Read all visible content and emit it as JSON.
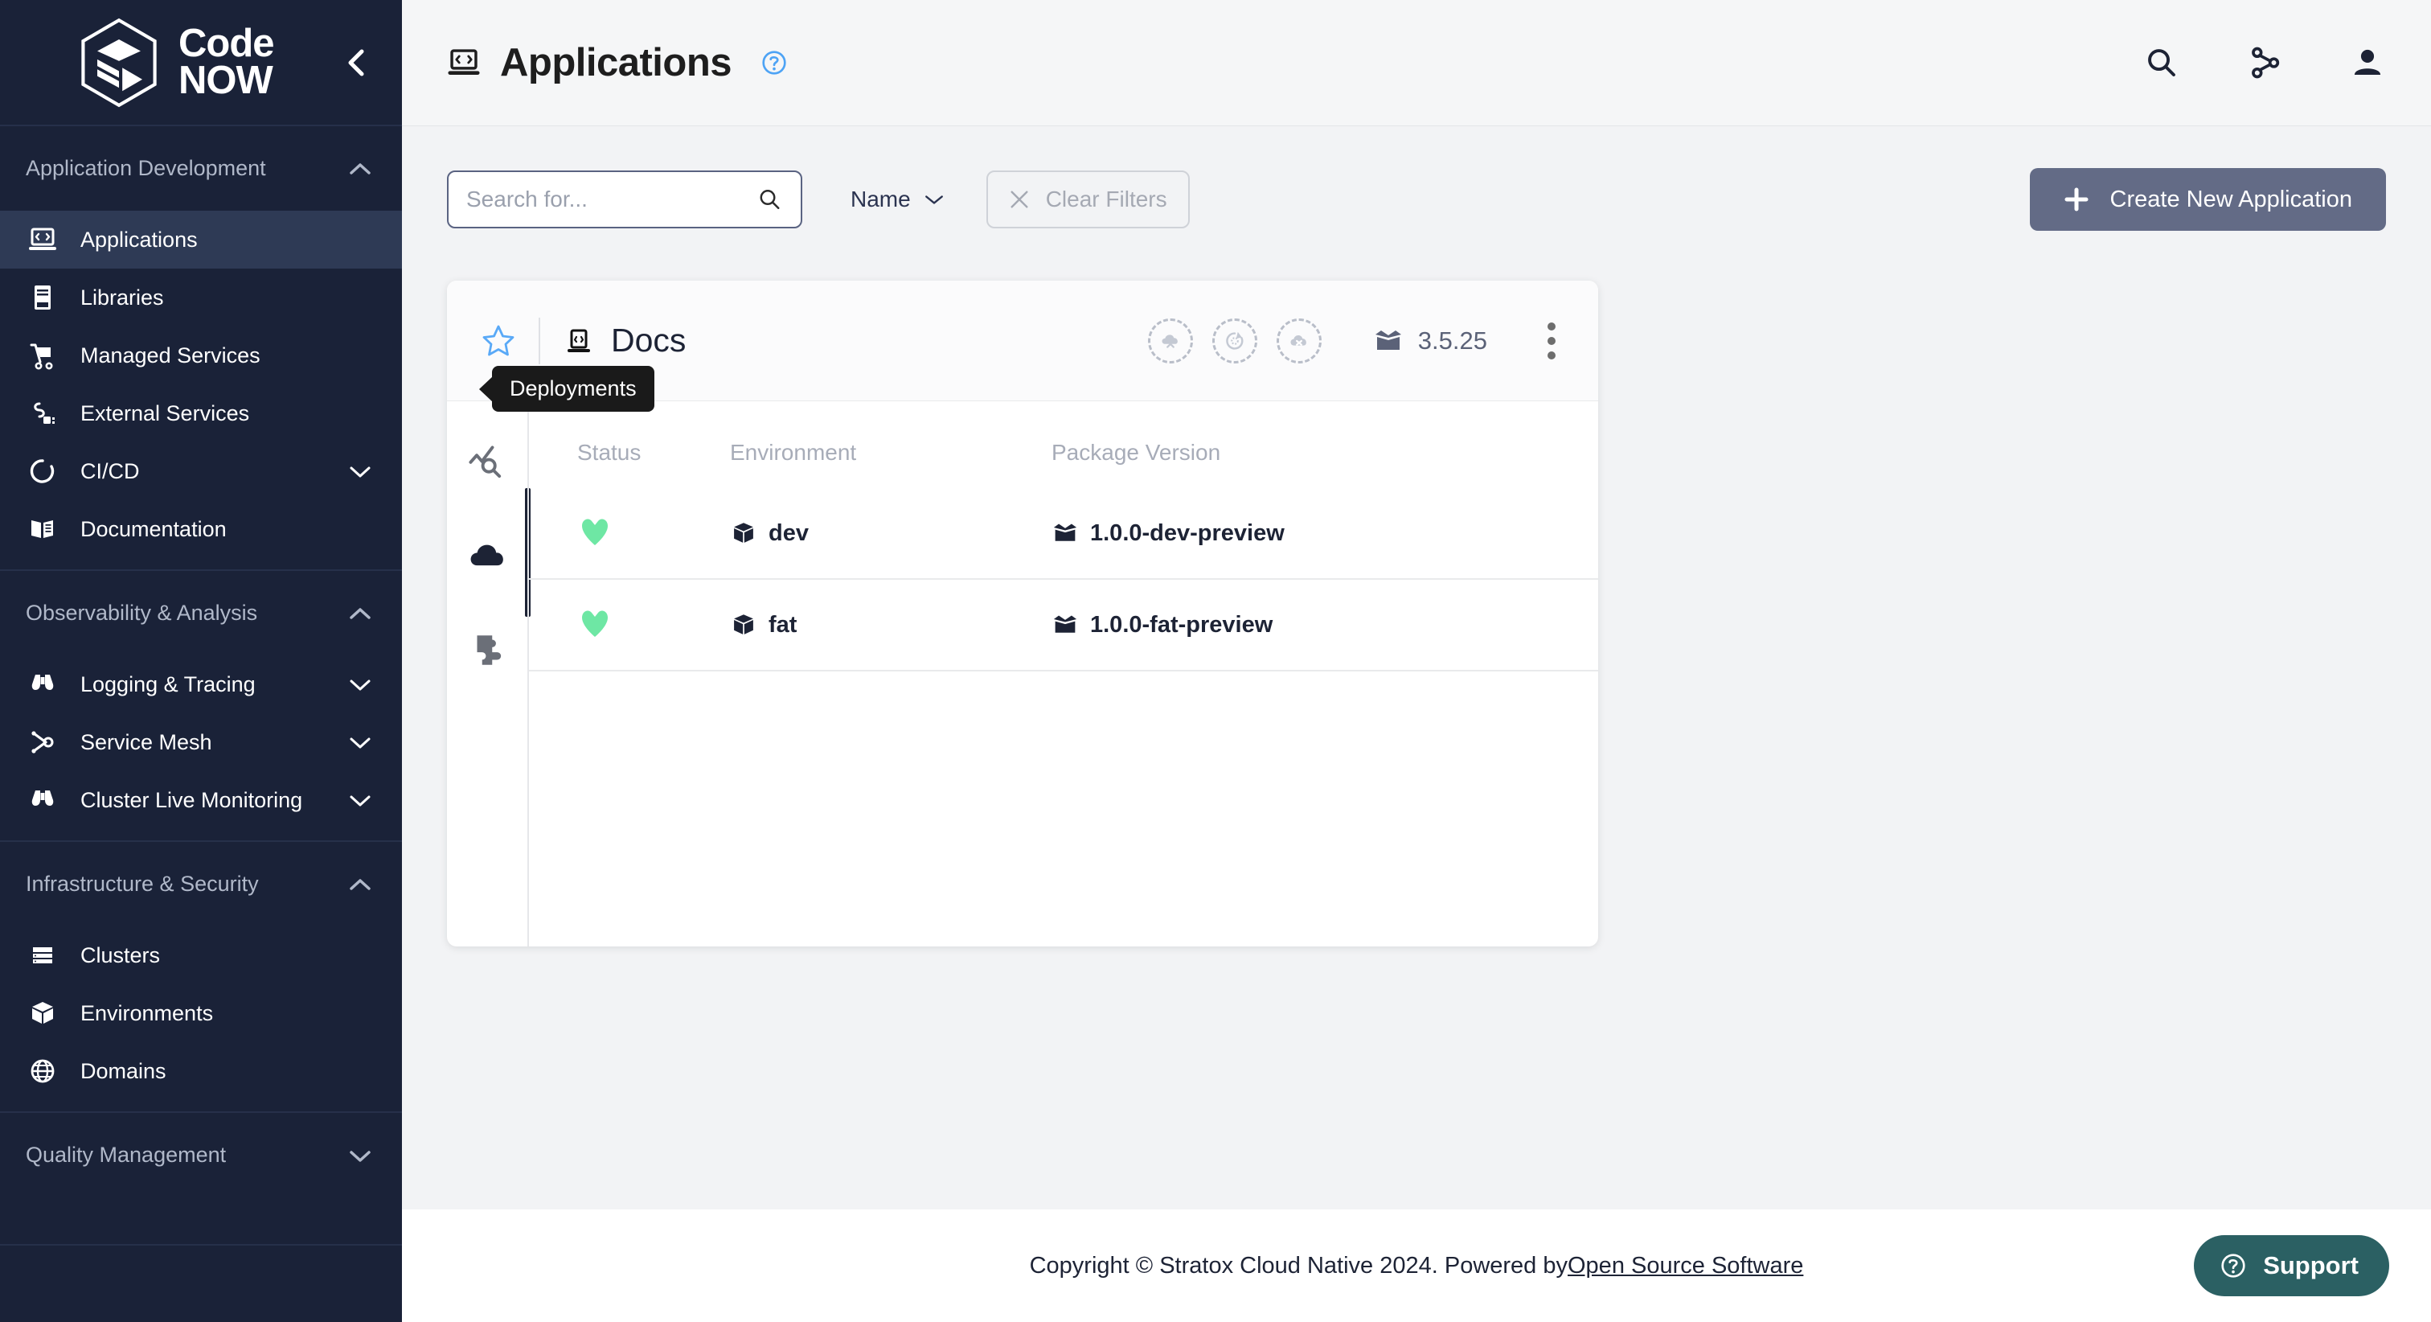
{
  "brand": {
    "name_line1": "Code",
    "name_line2": "NOW"
  },
  "sidebar": {
    "groups": [
      {
        "title": "Application Development",
        "expanded": true,
        "chevron": "chevron-up",
        "items": [
          {
            "label": "Applications",
            "icon": "laptop-code-icon",
            "active": true,
            "chevron": ""
          },
          {
            "label": "Libraries",
            "icon": "book-icon",
            "active": false,
            "chevron": ""
          },
          {
            "label": "Managed Services",
            "icon": "cart-icon",
            "active": false,
            "chevron": ""
          },
          {
            "label": "External Services",
            "icon": "plug-icon",
            "active": false,
            "chevron": ""
          },
          {
            "label": "CI/CD",
            "icon": "circle-loop-icon",
            "active": false,
            "chevron": "chevron-down"
          },
          {
            "label": "Documentation",
            "icon": "open-book-icon",
            "active": false,
            "chevron": ""
          }
        ]
      },
      {
        "title": "Observability & Analysis",
        "expanded": true,
        "chevron": "chevron-up",
        "items": [
          {
            "label": "Logging & Tracing",
            "icon": "binoculars-icon",
            "active": false,
            "chevron": "chevron-down"
          },
          {
            "label": "Service Mesh",
            "icon": "mesh-nodes-icon",
            "active": false,
            "chevron": "chevron-down"
          },
          {
            "label": "Cluster Live Monitoring",
            "icon": "binoculars-icon",
            "active": false,
            "chevron": "chevron-down"
          }
        ]
      },
      {
        "title": "Infrastructure & Security",
        "expanded": true,
        "chevron": "chevron-up",
        "items": [
          {
            "label": "Clusters",
            "icon": "server-rack-icon",
            "active": false,
            "chevron": ""
          },
          {
            "label": "Environments",
            "icon": "cube-icon",
            "active": false,
            "chevron": ""
          },
          {
            "label": "Domains",
            "icon": "globe-icon",
            "active": false,
            "chevron": ""
          }
        ]
      },
      {
        "title": "Quality Management",
        "expanded": false,
        "chevron": "chevron-down",
        "items": []
      }
    ],
    "collapse_icon": "chevron-left-icon"
  },
  "header": {
    "title": "Applications",
    "title_icon": "laptop-code-icon",
    "help_icon": "question-circle-icon",
    "actions": [
      {
        "name": "search-icon"
      },
      {
        "name": "git-branch-icon"
      },
      {
        "name": "user-avatar-icon"
      }
    ]
  },
  "toolbar": {
    "search_placeholder": "Search for...",
    "search_value": "",
    "search_icon": "search-icon",
    "sort_label": "Name",
    "sort_chevron": "chevron-down-icon",
    "clear_filters_label": "Clear Filters",
    "clear_filters_icon": "close-x-icon",
    "create_label": "Create New Application",
    "create_icon": "plus-icon"
  },
  "card": {
    "star_icon": "star-outline-icon",
    "app_icon": "laptop-code-icon",
    "app_name": "Docs",
    "circle_actions": [
      {
        "name": "cloud-deploy-icon"
      },
      {
        "name": "redeploy-icon"
      },
      {
        "name": "cloud-undeploy-icon"
      }
    ],
    "package_icon": "package-open-icon",
    "package_version": "3.5.25",
    "menu_icon": "kebab-menu-icon",
    "rail": [
      {
        "name": "metrics-analysis-icon",
        "active": false
      },
      {
        "name": "cloud-deployments-icon",
        "active": true
      },
      {
        "name": "puzzle-addons-icon",
        "active": false
      }
    ],
    "tooltip": "Deployments",
    "table": {
      "columns": [
        "Status",
        "Environment",
        "Package Version"
      ],
      "rows": [
        {
          "status_icon": "heart-healthy-icon",
          "status_color": "#6ee7a4",
          "environment_icon": "cube-icon",
          "environment": "dev",
          "package_icon": "package-open-icon",
          "package_version": "1.0.0-dev-preview"
        },
        {
          "status_icon": "heart-healthy-icon",
          "status_color": "#6ee7a4",
          "environment_icon": "cube-icon",
          "environment": "fat",
          "package_icon": "package-open-icon",
          "package_version": "1.0.0-fat-preview"
        }
      ]
    }
  },
  "footer": {
    "copyright": "Copyright © Stratox Cloud Native 2024. Powered by ",
    "link": "Open Source Software",
    "support_label": "Support",
    "support_icon": "question-circle-icon"
  },
  "colors": {
    "sidebar_bg": "#1a2238",
    "sidebar_active": "#2e3a55",
    "accent_blue": "#4da3f5",
    "create_btn": "#636b86",
    "support_bg": "#2b6063",
    "health_green": "#6ee7a4"
  }
}
